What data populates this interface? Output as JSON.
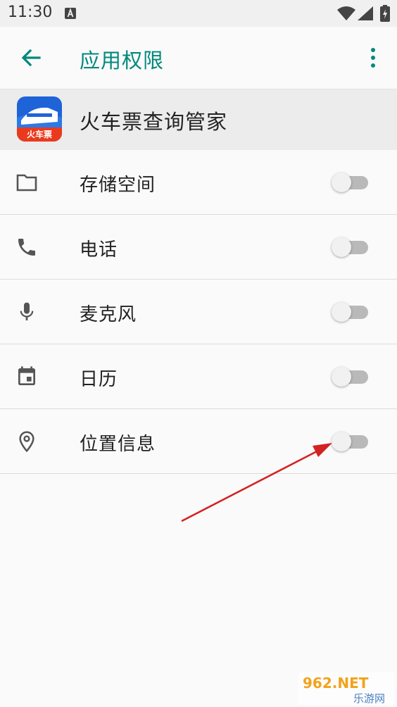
{
  "status_bar": {
    "time": "11:30",
    "icons": [
      "notification-a-icon",
      "wifi-icon",
      "signal-icon",
      "battery-icon"
    ]
  },
  "app_bar": {
    "title": "应用权限",
    "back_icon": "arrow-back-icon",
    "menu_icon": "more-vert-icon",
    "accent_color": "#00897b"
  },
  "app": {
    "name": "火车票查询管家",
    "logo_text": "火车票",
    "logo_icon": "train-logo-icon"
  },
  "permissions": [
    {
      "label": "存储空间",
      "icon": "folder-icon",
      "enabled": false
    },
    {
      "label": "电话",
      "icon": "phone-icon",
      "enabled": false
    },
    {
      "label": "麦克风",
      "icon": "microphone-icon",
      "enabled": false
    },
    {
      "label": "日历",
      "icon": "calendar-icon",
      "enabled": false
    },
    {
      "label": "位置信息",
      "icon": "location-pin-icon",
      "enabled": false
    }
  ],
  "annotation": {
    "arrow_color": "#d32222"
  },
  "watermark": {
    "top": "962.NET",
    "bottom": "乐游网"
  }
}
